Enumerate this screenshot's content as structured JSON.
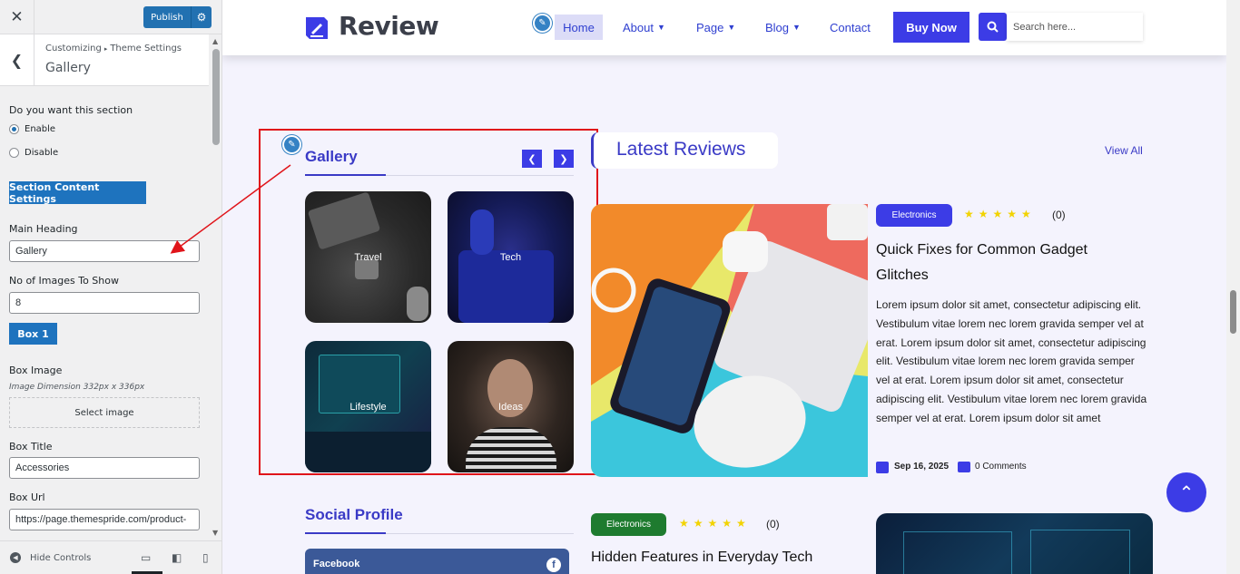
{
  "customizer": {
    "publish_label": "Publish",
    "breadcrumb": [
      "Customizing",
      "Theme Settings"
    ],
    "section_title": "Gallery",
    "section_question": "Do you want this section",
    "options": [
      {
        "label": "Enable",
        "checked": true
      },
      {
        "label": "Disable",
        "checked": false
      }
    ],
    "content_settings_label": "Section Content Settings",
    "main_heading_label": "Main Heading",
    "main_heading_value": "Gallery",
    "images_count_label": "No of Images To Show",
    "images_count_value": "8",
    "box_button_label": "Box 1",
    "box_image_label": "Box Image",
    "image_dimension": "Image Dimension 332px x 336px",
    "select_image_label": "Select image",
    "box_title_label": "Box Title",
    "box_title_value": "Accessories",
    "box_url_label": "Box Url",
    "box_url_value": "https://page.themespride.com/product-",
    "hide_controls_label": "Hide Controls"
  },
  "site": {
    "logo_text": "Review",
    "nav": [
      {
        "label": "Home",
        "active": true
      },
      {
        "label": "About",
        "has_dropdown": true
      },
      {
        "label": "Page",
        "has_dropdown": true
      },
      {
        "label": "Blog",
        "has_dropdown": true
      },
      {
        "label": "Contact"
      }
    ],
    "buy_now_label": "Buy Now",
    "search_placeholder": "Search here...",
    "accent_color": "#3c3ce6"
  },
  "gallery": {
    "heading": "Gallery",
    "tiles": [
      {
        "label": "Travel"
      },
      {
        "label": "Tech"
      },
      {
        "label": "Lifestyle"
      },
      {
        "label": "Ideas"
      }
    ]
  },
  "latest_reviews": {
    "heading": "Latest Reviews",
    "view_all_label": "View All",
    "posts": [
      {
        "category": "Electronics",
        "category_color": "#3c3ce6",
        "rating_count": "(0)",
        "title": "Quick Fixes for Common Gadget Glitches",
        "excerpt": "Lorem ipsum dolor sit amet, consectetur adipiscing elit. Vestibulum vitae lorem nec lorem gravida semper vel at erat. Lorem ipsum dolor sit amet, consectetur adipiscing elit. Vestibulum vitae lorem nec lorem gravida semper vel at erat. Lorem ipsum dolor sit amet, consectetur adipiscing elit. Vestibulum vitae lorem nec lorem gravida semper vel at erat. Lorem ipsum dolor sit amet",
        "date": "Sep 16, 2025",
        "comments": "0 Comments"
      },
      {
        "category": "Electronics",
        "category_color": "#1e7b2f",
        "rating_count": "(0)",
        "title": "Hidden Features in Everyday Tech"
      }
    ]
  },
  "social": {
    "heading": "Social Profile",
    "networks": [
      {
        "label": "Facebook",
        "icon": "facebook-icon"
      }
    ]
  }
}
